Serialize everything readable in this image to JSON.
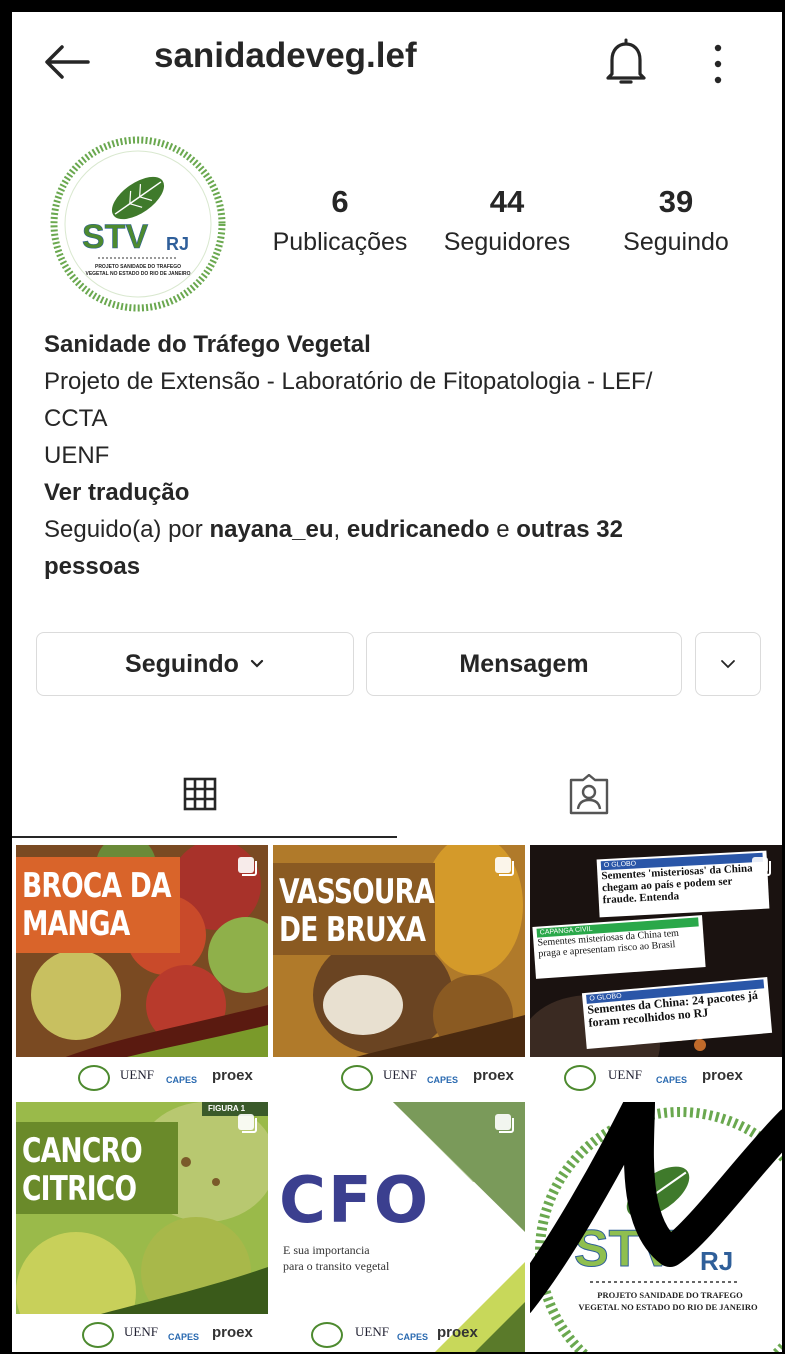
{
  "header": {
    "username": "sanidadeveg.lef",
    "back_icon": "arrow-left-icon",
    "bell_icon": "bell-icon",
    "more_icon": "more-vertical-icon"
  },
  "avatar": {
    "logo_text": "STV",
    "logo_suffix": "RJ",
    "logo_caption_1": "PROJETO SANIDADE DO TRAFEGO",
    "logo_caption_2": "VEGETAL NO ESTADO DO RIO DE JANEIRO"
  },
  "stats": [
    {
      "value": "6",
      "label": "Publicações"
    },
    {
      "value": "44",
      "label": "Seguidores"
    },
    {
      "value": "39",
      "label": "Seguindo"
    }
  ],
  "bio": {
    "name": "Sanidade do Tráfego Vegetal",
    "line1": "Projeto de Extensão - Laboratório de Fitopatologia - LEF/",
    "line2": "CCTA",
    "line3": "UENF",
    "translate": "Ver tradução",
    "followed_prefix": "Seguido(a) por ",
    "followed_user1": "nayana_eu",
    "followed_sep": ", ",
    "followed_user2": "eudricanedo",
    "followed_and": " e ",
    "followed_others_1": "outras 32",
    "followed_others_2": "pessoas"
  },
  "actions": {
    "following_label": "Seguindo",
    "message_label": "Mensagem"
  },
  "tabs": {
    "grid_icon": "grid-icon",
    "tagged_icon": "tagged-person-icon"
  },
  "posts": [
    {
      "title_1": "BROCA DA",
      "title_2": "MANGA"
    },
    {
      "title_1": "VASSOURA",
      "title_2": "DE BRUXA"
    },
    {
      "news_1_src": "O GLOBO",
      "news_1": "Sementes 'misteriosas' da China chegam ao país e podem ser fraude. Entenda",
      "news_2_src": "CAPANGA CIVIL",
      "news_2": "Sementes misteriosas da China tem praga e apresentam risco ao Brasil",
      "news_3_src": "O GLOBO",
      "news_3": "Sementes da China: 24 pacotes já foram recolhidos no RJ"
    },
    {
      "title_1": "CANCRO",
      "title_2": "CITRICO",
      "figure": "FIGURA 1"
    },
    {
      "title": "CFO",
      "subtitle_1": "E sua importancia",
      "subtitle_2": "para o transito vegetal"
    },
    {
      "logo_text": "STV",
      "logo_suffix": "RJ",
      "caption_1": "PROJETO SANIDADE DO TRAFEGO",
      "caption_2": "VEGETAL NO ESTADO DO RIO DE JANEIRO"
    }
  ],
  "partner_logos": {
    "uenf": "UENF",
    "capes": "CAPES",
    "proex": "proex"
  },
  "colors": {
    "stv_green": "#4d8a2f",
    "stv_blue": "#2f5f9a",
    "cfo_purple": "#3b3f8f"
  }
}
